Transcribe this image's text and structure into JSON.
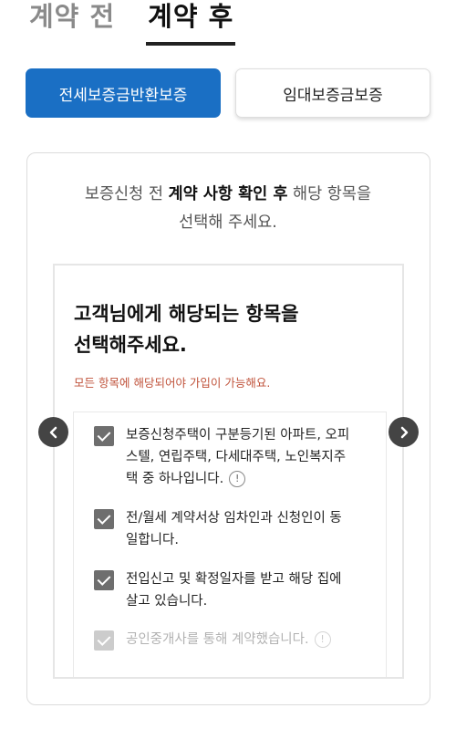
{
  "tabs": [
    {
      "label": "계약 전"
    },
    {
      "label": "계약 후"
    }
  ],
  "type_buttons": {
    "selected": "전세보증금반환보증",
    "other": "임대보증금보증"
  },
  "instruction": {
    "prefix": "보증신청 전 ",
    "bold": "계약 사항 확인 후",
    "suffix": " 해당 항목을",
    "line2": "선택해 주세요."
  },
  "inner": {
    "title_line1": "고객님에게 해당되는 항목을",
    "title_line2": "선택해주세요.",
    "notice": "모든 항목에 해당되어야 가입이 가능해요."
  },
  "items": [
    {
      "line1": "보증신청주택이 구분등기된 아파트, 오피",
      "line2": "스텔, 연립주택, 다세대주택, 노인복지주",
      "line3": "택 중 하나입니다.",
      "info": "!"
    },
    {
      "line1": "전/월세 계약서상 임차인과 신청인이 동",
      "line2": "일합니다."
    },
    {
      "line1": "전입신고 및 확정일자를 받고 해당 집에",
      "line2": "살고 있습니다."
    },
    {
      "line1": "공인중개사를 통해 계약했습니다.",
      "info": "!"
    }
  ]
}
